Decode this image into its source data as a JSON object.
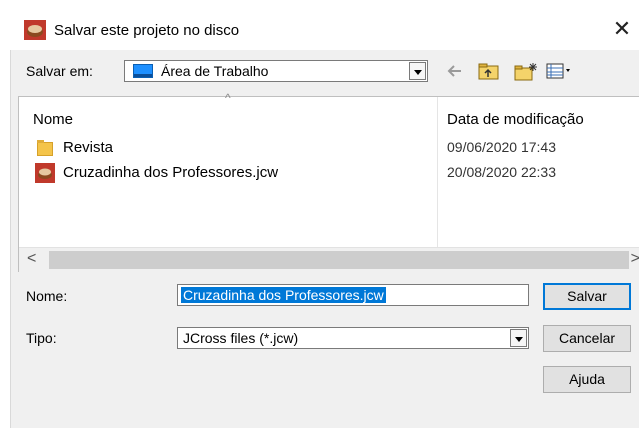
{
  "window": {
    "title": "Salvar este projeto no disco",
    "close_glyph": "✕"
  },
  "toolbar": {
    "save_in_label": "Salvar em:",
    "save_in_value": "Área de Trabalho",
    "icons": [
      "back-arrow-icon",
      "up-folder-icon",
      "new-folder-icon",
      "view-menu-icon"
    ]
  },
  "filelist": {
    "columns": {
      "name": "Nome",
      "date": "Data de modificação"
    },
    "rows": [
      {
        "name": "Revista",
        "date": "09/06/2020 17:43",
        "icon": "folder-icon"
      },
      {
        "name": "Cruzadinha dos Professores.jcw",
        "date": "20/08/2020 22:33",
        "icon": "jcross-file-icon"
      }
    ]
  },
  "form": {
    "name_label": "Nome:",
    "name_value": "Cruzadinha dos Professores.jcw",
    "type_label": "Tipo:",
    "type_value": "JCross files (*.jcw)"
  },
  "buttons": {
    "save": "Salvar",
    "cancel": "Cancelar",
    "help": "Ajuda"
  },
  "colors": {
    "selection": "#0078d7",
    "desktop_icon": "#1e90ff",
    "folder": "#f4c44a",
    "app_icon": "#c0392b"
  }
}
